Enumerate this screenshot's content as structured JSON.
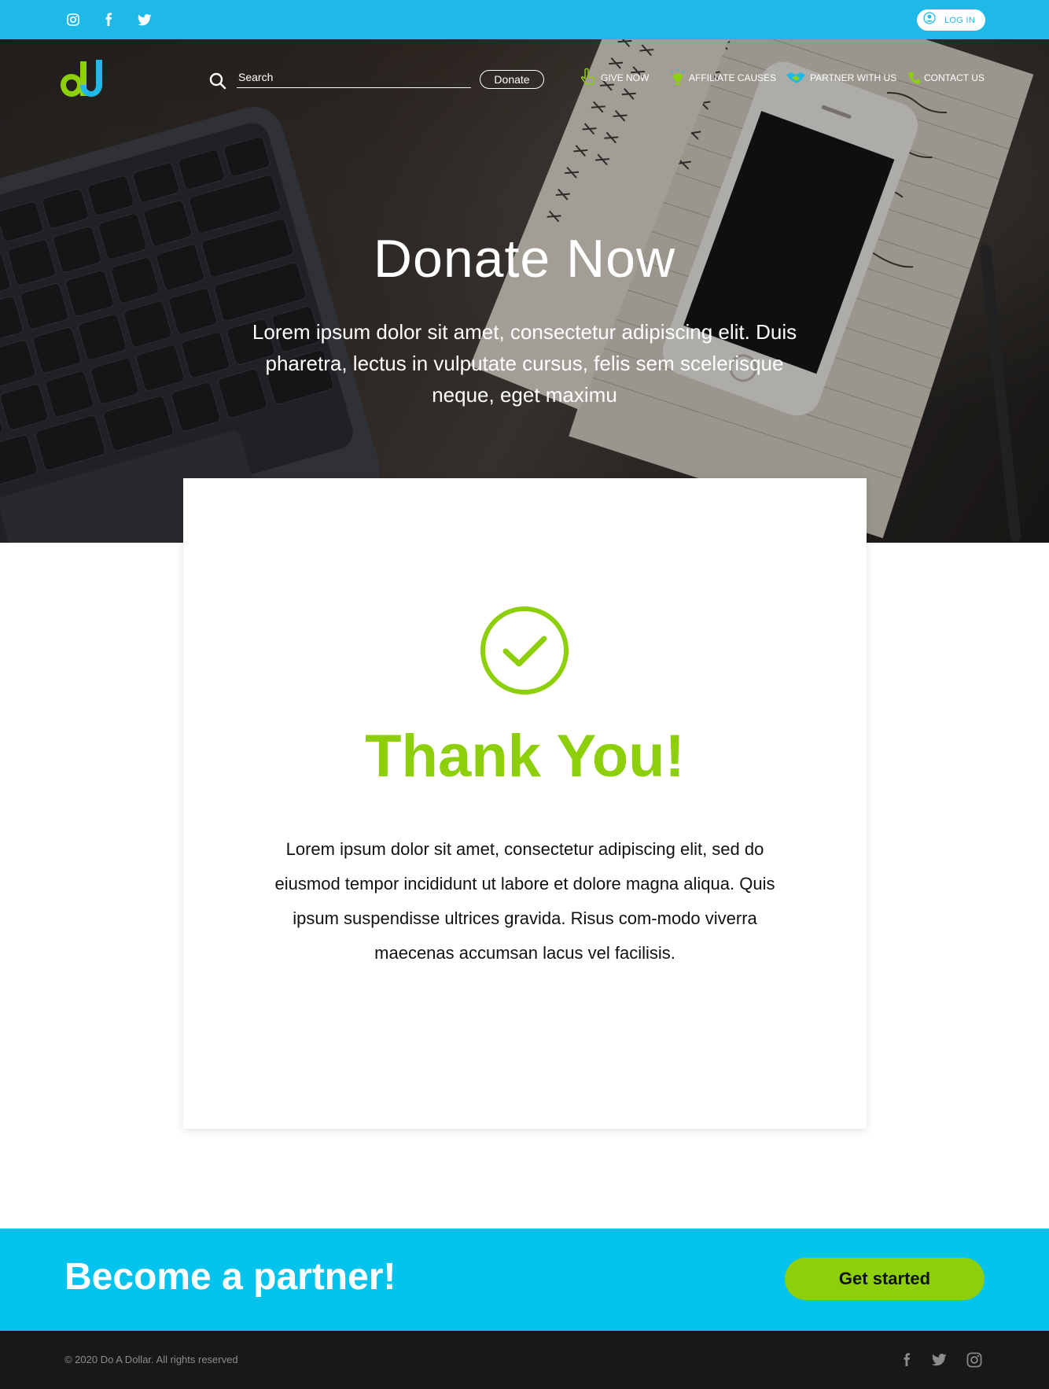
{
  "topbar": {
    "social": [
      "instagram-icon",
      "facebook-icon",
      "twitter-icon"
    ],
    "login_label": "LOG IN"
  },
  "header": {
    "search_placeholder": "Search",
    "donate_label": "Donate",
    "nav": [
      {
        "label": "GIVE NOW",
        "icon": "hand-pointer-icon"
      },
      {
        "label": "AFFILIATE CAUSES",
        "icon": "lightbulb-icon"
      },
      {
        "label": "PARTNER WITH US",
        "icon": "handshake-icon"
      },
      {
        "label": "CONTACT US",
        "icon": "phone-icon"
      }
    ]
  },
  "hero": {
    "title": "Donate Now",
    "text": "Lorem ipsum dolor sit amet, consectetur adipiscing elit. Duis pharetra, lectus in vulputate cursus, felis sem scelerisque neque, eget maximu"
  },
  "card": {
    "icon": "check-circle-icon",
    "title": "Thank You!",
    "text": "Lorem ipsum dolor sit amet, consectetur adipiscing elit, sed do eiusmod tempor incididunt ut labore et dolore magna aliqua. Quis ipsum suspendisse ultrices gravida. Risus com-modo viverra maecenas accumsan lacus vel facilisis."
  },
  "partner": {
    "title": "Become a partner!",
    "cta_label": "Get started"
  },
  "footer": {
    "copyright": "© 2020 Do A Dollar. All rights reserved",
    "social": [
      "facebook-icon",
      "twitter-icon",
      "instagram-icon"
    ]
  },
  "colors": {
    "topbar": "#1fb9e8",
    "accent_green": "#8ccf0a",
    "partner_bg": "#04c3ed",
    "footer_bg": "#181818"
  }
}
